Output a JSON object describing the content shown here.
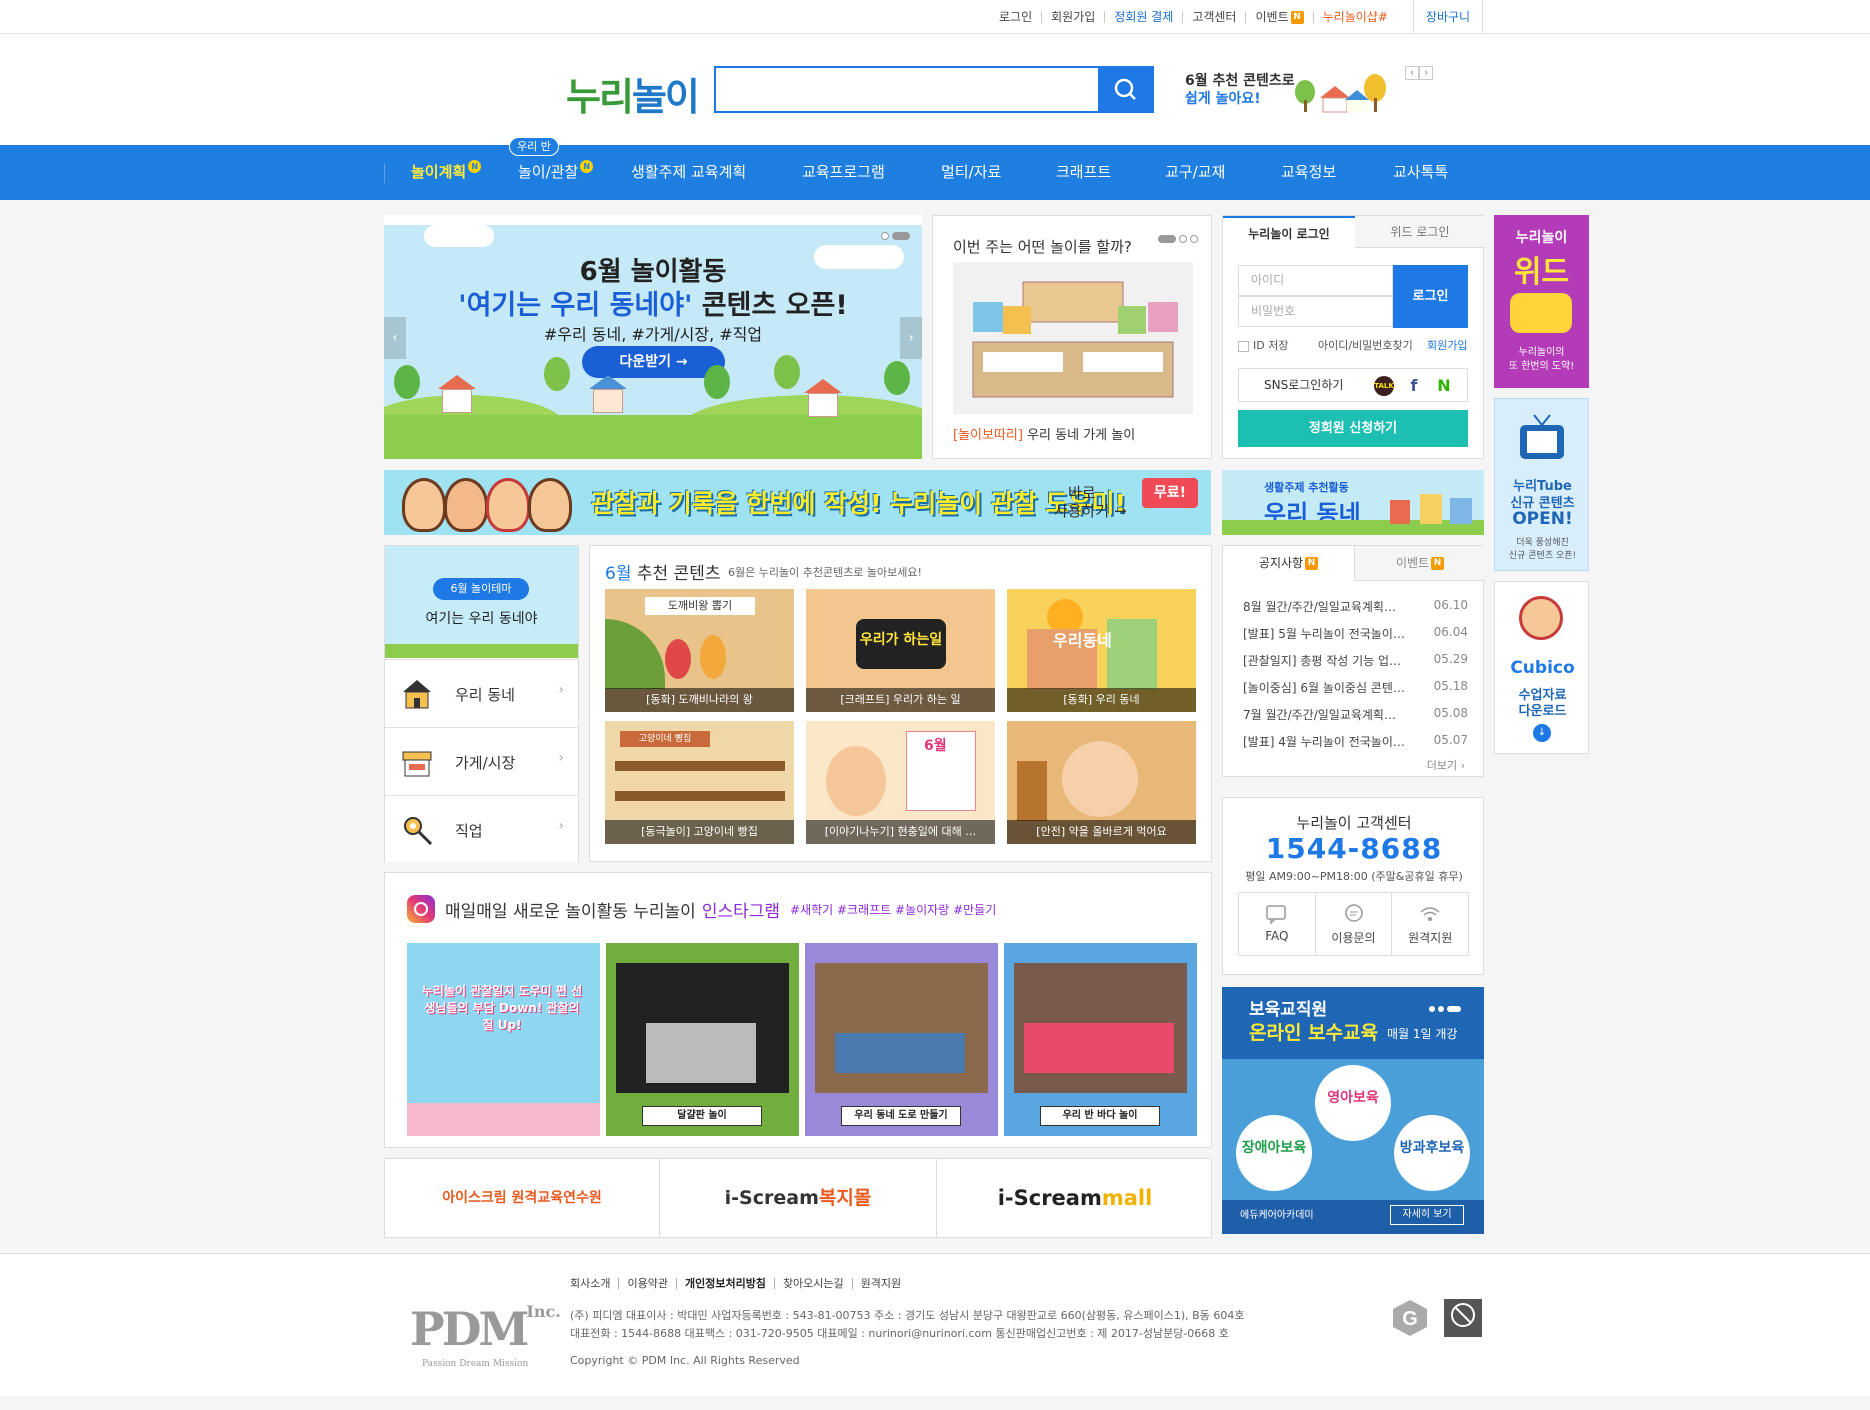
{
  "topbar": {
    "links": [
      "로그인",
      "회원가입",
      "정회원 결제",
      "고객센터",
      "이벤트",
      "누리놀이샵#"
    ],
    "event_badge": "N",
    "cart": "장바구니"
  },
  "header": {
    "logo_part1": "누리",
    "logo_part2": "놀이",
    "search_placeholder": "",
    "promo_line1": "6월 추천 콘텐츠로",
    "promo_line2": "쉽게 놀아요!"
  },
  "nav": {
    "items": [
      "놀이계획",
      "놀이/관찰",
      "생활주제 교육계획",
      "교육프로그램",
      "멀티/자료",
      "크래프트",
      "교구/교재",
      "교육정보",
      "교사톡톡"
    ],
    "badge": "N",
    "bubble": "우리 반"
  },
  "main_banner": {
    "title": "6월 놀이활동",
    "headline1": "'여기는 우리 동네야'",
    "headline2": "콘텐츠 오픈!",
    "tags": "#우리 동네, #가게/시장, #직업",
    "button": "다운받기 →"
  },
  "play_card": {
    "question": "이번 주는 어떤 놀이를 할까?",
    "caption_tag": "[놀이보따리]",
    "caption": " 우리 동네 가게 놀이"
  },
  "login": {
    "tab_active": "누리놀이 로그인",
    "tab_other": "위드 로그인",
    "id_placeholder": "아이디",
    "pw_placeholder": "비밀번호",
    "login_button": "로그인",
    "save_id": "ID 저장",
    "find": "아이디/비밀번호찾기",
    "join": "회원가입",
    "sns": "SNS로그인하기",
    "sns_icons": [
      "TALK",
      "f",
      "N"
    ],
    "regular_join": "정회원 신청하기"
  },
  "side_banners": {
    "with": {
      "line1": "누리놀이",
      "line2": "위드",
      "line3": "누리놀이의",
      "line4": "또 한번의 도약!"
    },
    "tube": {
      "line1": "누리Tube",
      "line2": "신규 콘텐츠",
      "line3": "OPEN!",
      "line4": "더욱 풍성해진",
      "line5": "신규 콘텐츠 오픈!"
    },
    "cubico": {
      "logo": "Cubico",
      "line1": "수업자료",
      "line2": "다운로드"
    }
  },
  "observation_banner": {
    "text": "관찰과 기록을 한번에 작성! 누리놀이 관찰 도우미!",
    "go1": "바로",
    "go2": "사용하기 →",
    "free": "무료!"
  },
  "village_banner": {
    "small": "생활주제 추천활동",
    "big": "우리 동네"
  },
  "theme": {
    "pill": "6월 놀이테마",
    "name": "여기는 우리 동네야",
    "rows": [
      "우리 동네",
      "가게/시장",
      "직업"
    ]
  },
  "recommend": {
    "month": "6월",
    "title": " 추천 콘텐츠",
    "subtitle": "6월은 누리놀이 추천콘텐츠로 놀아보세요!",
    "items": [
      {
        "caption": "[동화] 도깨비나라의 왕",
        "label": "도깨비왕 뽑기"
      },
      {
        "caption": "[크래프트] 우리가 하는 일",
        "label": "우리가 하는일"
      },
      {
        "caption": "[동화] 우리 동네",
        "label": "우리동네"
      },
      {
        "caption": "[동극놀이] 고양이네 빵집",
        "label": "고양이네 빵집"
      },
      {
        "caption": "[이야기나누기] 현충일에 대해 …",
        "label": "6월"
      },
      {
        "caption": "[안전] 약을 올바르게 먹어요",
        "label": ""
      }
    ]
  },
  "notice": {
    "tab_active": "공지사항",
    "tab_other": "이벤트",
    "badge": "N",
    "items": [
      {
        "title": "8월 월간/주간/일일교육계획…",
        "date": "06.10"
      },
      {
        "title": "[발표] 5월 누리놀이 전국놀이…",
        "date": "06.04"
      },
      {
        "title": "[관찰일지] 총평 작성 기능 업…",
        "date": "05.29"
      },
      {
        "title": "[놀이중심] 6월 놀이중심 콘텐…",
        "date": "05.18"
      },
      {
        "title": "7월 월간/주간/일일교육계획…",
        "date": "05.08"
      },
      {
        "title": "[발표] 4월 누리놀이 전국놀이…",
        "date": "05.07"
      }
    ],
    "more": "더보기 ›"
  },
  "customer_center": {
    "title": "누리놀이 고객센터",
    "phone": "1544-8688",
    "hours": "평일 AM9:00~PM18:00 (주말&공휴일 휴무)",
    "items": [
      "FAQ",
      "이용문의",
      "원격지원"
    ]
  },
  "instagram": {
    "title": "매일매일 새로운 놀이활동 누리놀이",
    "accent": "인스타그램",
    "tags": "#새학기 #크래프트 #놀이자랑 #만들기",
    "posts": [
      {
        "caption": "",
        "text": "누리놀이 관찰일지 도우미 편 선생님들의 부담 Down! 관찰의 질 Up!"
      },
      {
        "caption": "달걀판 놀이",
        "text": ""
      },
      {
        "caption": "우리 동네 도로 만들기",
        "text": ""
      },
      {
        "caption": "우리 반 바다 놀이",
        "text": ""
      }
    ]
  },
  "edu_banner": {
    "line1": "보육교직원",
    "line2": "온라인 보수교육",
    "line3": "매월 1일 개강",
    "circles": [
      "영아보육",
      "장애아보육",
      "방과후보육"
    ],
    "logo": "에듀케어아카데미",
    "more": "자세히 보기"
  },
  "partners": {
    "p1": "아이스크림 원격교육연수원",
    "p2a": "i-Scream",
    "p2b": "복지몰",
    "p3a": "i-Scream",
    "p3b": "mall"
  },
  "footer": {
    "links": [
      "회사소개",
      "이용약관",
      "개인정보처리방침",
      "찾아오시는길",
      "원격지원"
    ],
    "line1": "(주) 피디엠 대표이사 : 박대민 사업자등록번호 : 543-81-00753 주소 : 경기도 성남시 분당구 대왕판교로 660(삼평동, 유스페이스1), B동 604호",
    "line2": "대표전화 : 1544-8688 대표팩스 : 031-720-9505 대표메일 : nurinori@nurinori.com 통신판매업신고번호 : 제 2017-성남분당-0668 호",
    "copyright": "Copyright © PDM Inc. All Rights Reserved",
    "logo": "PDM",
    "logo_inc": "Inc.",
    "logo_sub": "Passion Dream Mission"
  },
  "colors": {
    "brand_blue": "#1e7fe0",
    "accent_orange": "#e85a1e",
    "teal": "#1dbfb2",
    "nav_active": "#ffea3a"
  }
}
